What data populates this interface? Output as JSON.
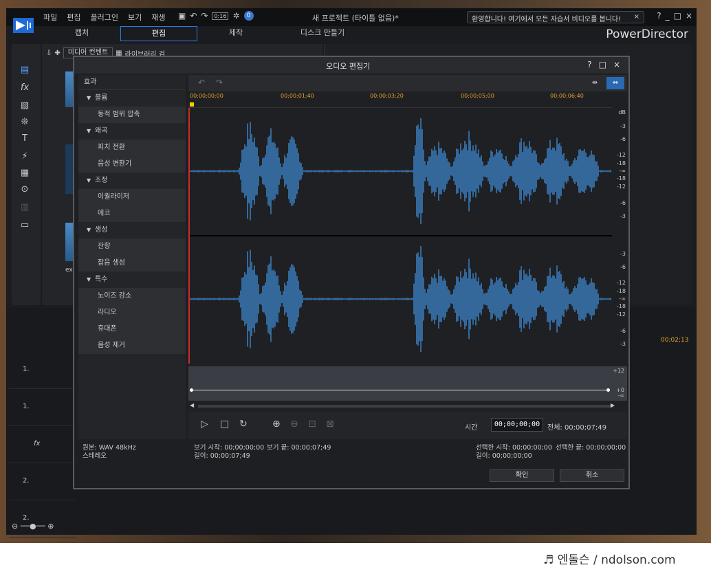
{
  "app": {
    "menu": [
      "파일",
      "편집",
      "플러그인",
      "보기",
      "재생"
    ],
    "duration_badge": "0:16",
    "doc_title": "새 프로젝트 (타이틀 없음)*",
    "welcome_text": "환영합니다! 여기에서 모든 자습서 비디오를 봅니다!",
    "mode_tabs": [
      "캡처",
      "편집",
      "제작",
      "디스크 만들기"
    ],
    "active_tab": "편집",
    "brand": "PowerDirector",
    "media_dropdown": "미디어 컨텐트",
    "library_label": "라이브러리 검",
    "thumb_caption": "extre",
    "timeline_tc": "00;02;13",
    "tracks": [
      "1.",
      "1.",
      "",
      "2.",
      "2."
    ]
  },
  "dialog": {
    "title": "오디오 편집기",
    "effects_header": "효과",
    "categories": [
      {
        "label": "볼륨",
        "items": [
          "동적 범위 압축"
        ]
      },
      {
        "label": "왜곡",
        "items": [
          "피치 전환",
          "음성 변환기"
        ]
      },
      {
        "label": "조정",
        "items": [
          "이퀄라이저",
          "에코"
        ]
      },
      {
        "label": "생성",
        "items": [
          "잔향",
          "잡음 생성"
        ]
      },
      {
        "label": "특수",
        "items": [
          "노이즈 감소",
          "라디오",
          "휴대폰",
          "음성 제거"
        ]
      }
    ],
    "ruler_ticks": [
      "00;00;00;00",
      "00;00;01;40",
      "00;00;03;20",
      "00;00;05;00",
      "00;00;06;40"
    ],
    "db_label": "dB",
    "db_top": [
      "-3",
      "-6",
      "-12",
      "-18",
      "-∞",
      "-18",
      "-12",
      "-6",
      "-3"
    ],
    "db_bottom": [
      "-3",
      "-6",
      "-12",
      "-18",
      "-∞",
      "-18",
      "-12",
      "-6",
      "-3"
    ],
    "env_top": "+12",
    "env_zero": "+0",
    "env_bottom": "-∞",
    "time_label": "시간",
    "time_value": "00;00;00;00",
    "total": "전체: 00;00;07;49",
    "source": "원본: WAV 48kHz",
    "channels": "스테레오",
    "view_start": "보기 시작: 00;00;00;00",
    "view_end": "보기 끝: 00;00;07;49",
    "length": "길이: 00;00;07;49",
    "sel_start": "선택한 시작: 00;00;00;00",
    "sel_end": "선택한 끝: 00;00;00;00",
    "sel_length": "길이: 00;00;00;00",
    "confirm": "확인",
    "cancel": "취소"
  },
  "footer": "♬ 엔돌슨 / ndolson.com",
  "colors": {
    "accent": "#2a7de1",
    "wave": "#3a7ab8",
    "playhead": "#cc2a2a",
    "marker": "#f0d000"
  }
}
